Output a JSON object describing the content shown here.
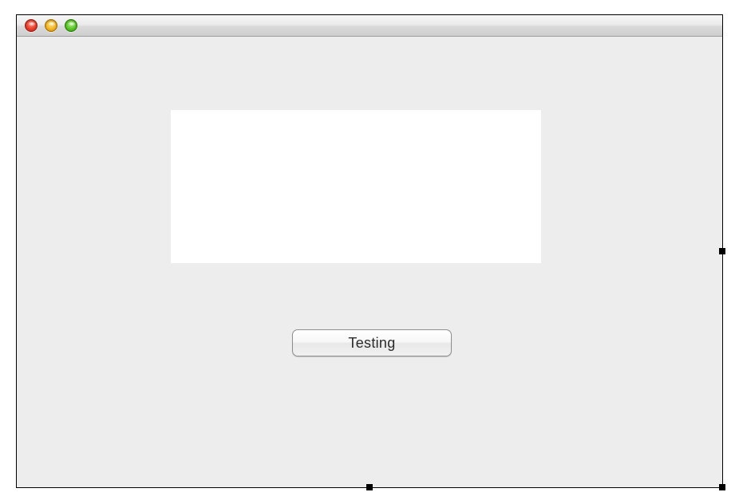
{
  "window": {
    "title": ""
  },
  "main": {
    "button_label": "Testing"
  }
}
